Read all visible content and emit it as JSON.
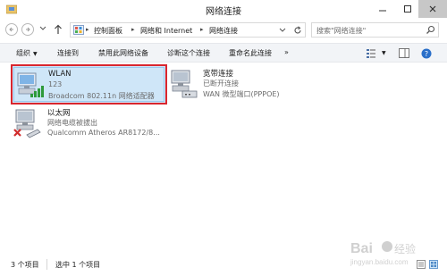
{
  "window": {
    "title": "网络连接"
  },
  "address_bar": {
    "breadcrumbs": [
      "控制面板",
      "网络和 Internet",
      "网络连接"
    ],
    "search_placeholder": "搜索\"网络连接\""
  },
  "toolbar": {
    "items": [
      {
        "label": "组织",
        "has_dropdown": true
      },
      {
        "label": "连接到"
      },
      {
        "label": "禁用此网络设备"
      },
      {
        "label": "诊断这个连接"
      },
      {
        "label": "重命名此连接"
      },
      {
        "label": "»"
      }
    ]
  },
  "connections": [
    {
      "name": "WLAN",
      "status": "123",
      "device": "Broadcom 802.11n 网络适配器",
      "selected": true,
      "icon": "wifi-adapter-icon"
    },
    {
      "name": "宽带连接",
      "status": "已断开连接",
      "device": "WAN 微型端口(PPPOE)",
      "selected": false,
      "icon": "broadband-modem-icon"
    },
    {
      "name": "以太网",
      "status": "网络电缆被拔出",
      "device": "Qualcomm Atheros AR8172/8...",
      "selected": false,
      "icon": "ethernet-disconnected-icon"
    }
  ],
  "status_bar": {
    "item_count": "3 个项目",
    "selected_count": "选中 1 个项目"
  },
  "colors": {
    "selection_fill": "#cfe6f8",
    "highlight_border": "#d9262e",
    "wifi_bars": "#2f9a3b"
  }
}
